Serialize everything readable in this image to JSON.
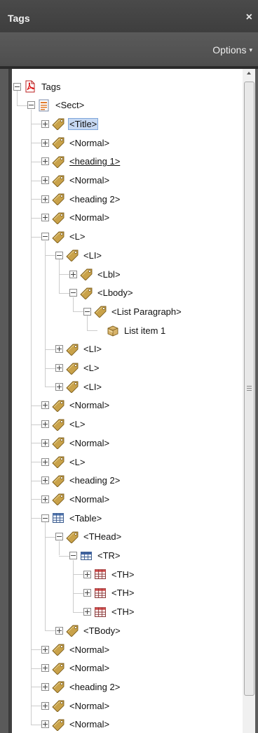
{
  "panel": {
    "title": "Tags",
    "close_glyph": "×",
    "options_label": "Options",
    "options_caret": "▾"
  },
  "tree": [
    {
      "depth": 0,
      "label": "Tags",
      "icon": "pdf-document-icon",
      "expander": "minus"
    },
    {
      "depth": 1,
      "label": "<Sect>",
      "icon": "section-icon",
      "expander": "minus"
    },
    {
      "depth": 2,
      "label": "<Title>",
      "icon": "tag-icon",
      "expander": "plus",
      "selected": true
    },
    {
      "depth": 2,
      "label": "<Normal>",
      "icon": "tag-icon",
      "expander": "plus"
    },
    {
      "depth": 2,
      "label": "<heading 1>",
      "icon": "tag-icon",
      "expander": "plus",
      "underline": true
    },
    {
      "depth": 2,
      "label": "<Normal>",
      "icon": "tag-icon",
      "expander": "plus"
    },
    {
      "depth": 2,
      "label": "<heading 2>",
      "icon": "tag-icon",
      "expander": "plus"
    },
    {
      "depth": 2,
      "label": "<Normal>",
      "icon": "tag-icon",
      "expander": "plus"
    },
    {
      "depth": 2,
      "label": "<L>",
      "icon": "tag-icon",
      "expander": "minus"
    },
    {
      "depth": 3,
      "label": "<LI>",
      "icon": "tag-icon",
      "expander": "minus"
    },
    {
      "depth": 4,
      "label": "<Lbl>",
      "icon": "tag-icon",
      "expander": "plus"
    },
    {
      "depth": 4,
      "label": "<Lbody>",
      "icon": "tag-icon",
      "expander": "minus"
    },
    {
      "depth": 5,
      "label": "<List Paragraph>",
      "icon": "tag-icon",
      "expander": "minus"
    },
    {
      "depth": 6,
      "label": "List item 1",
      "icon": "content-box-icon",
      "expander": "none"
    },
    {
      "depth": 3,
      "label": "<LI>",
      "icon": "tag-icon",
      "expander": "plus"
    },
    {
      "depth": 3,
      "label": "<L>",
      "icon": "tag-icon",
      "expander": "plus"
    },
    {
      "depth": 3,
      "label": "<LI>",
      "icon": "tag-icon",
      "expander": "plus"
    },
    {
      "depth": 2,
      "label": "<Normal>",
      "icon": "tag-icon",
      "expander": "plus"
    },
    {
      "depth": 2,
      "label": "<L>",
      "icon": "tag-icon",
      "expander": "plus"
    },
    {
      "depth": 2,
      "label": "<Normal>",
      "icon": "tag-icon",
      "expander": "plus"
    },
    {
      "depth": 2,
      "label": "<L>",
      "icon": "tag-icon",
      "expander": "plus"
    },
    {
      "depth": 2,
      "label": "<heading 2>",
      "icon": "tag-icon",
      "expander": "plus"
    },
    {
      "depth": 2,
      "label": "<Normal>",
      "icon": "tag-icon",
      "expander": "plus"
    },
    {
      "depth": 2,
      "label": "<Table>",
      "icon": "table-icon",
      "expander": "minus"
    },
    {
      "depth": 3,
      "label": "<THead>",
      "icon": "tag-icon",
      "expander": "minus"
    },
    {
      "depth": 4,
      "label": "<TR>",
      "icon": "table-row-icon",
      "expander": "minus"
    },
    {
      "depth": 5,
      "label": "<TH>",
      "icon": "table-cell-icon",
      "expander": "plus"
    },
    {
      "depth": 5,
      "label": "<TH>",
      "icon": "table-cell-icon",
      "expander": "plus"
    },
    {
      "depth": 5,
      "label": "<TH>",
      "icon": "table-cell-icon",
      "expander": "plus"
    },
    {
      "depth": 3,
      "label": "<TBody>",
      "icon": "tag-icon",
      "expander": "plus"
    },
    {
      "depth": 2,
      "label": "<Normal>",
      "icon": "tag-icon",
      "expander": "plus"
    },
    {
      "depth": 2,
      "label": "<Normal>",
      "icon": "tag-icon",
      "expander": "plus"
    },
    {
      "depth": 2,
      "label": "<heading 2>",
      "icon": "tag-icon",
      "expander": "plus"
    },
    {
      "depth": 2,
      "label": "<Normal>",
      "icon": "tag-icon",
      "expander": "plus"
    },
    {
      "depth": 2,
      "label": "<Normal>",
      "icon": "tag-icon",
      "expander": "plus"
    }
  ]
}
